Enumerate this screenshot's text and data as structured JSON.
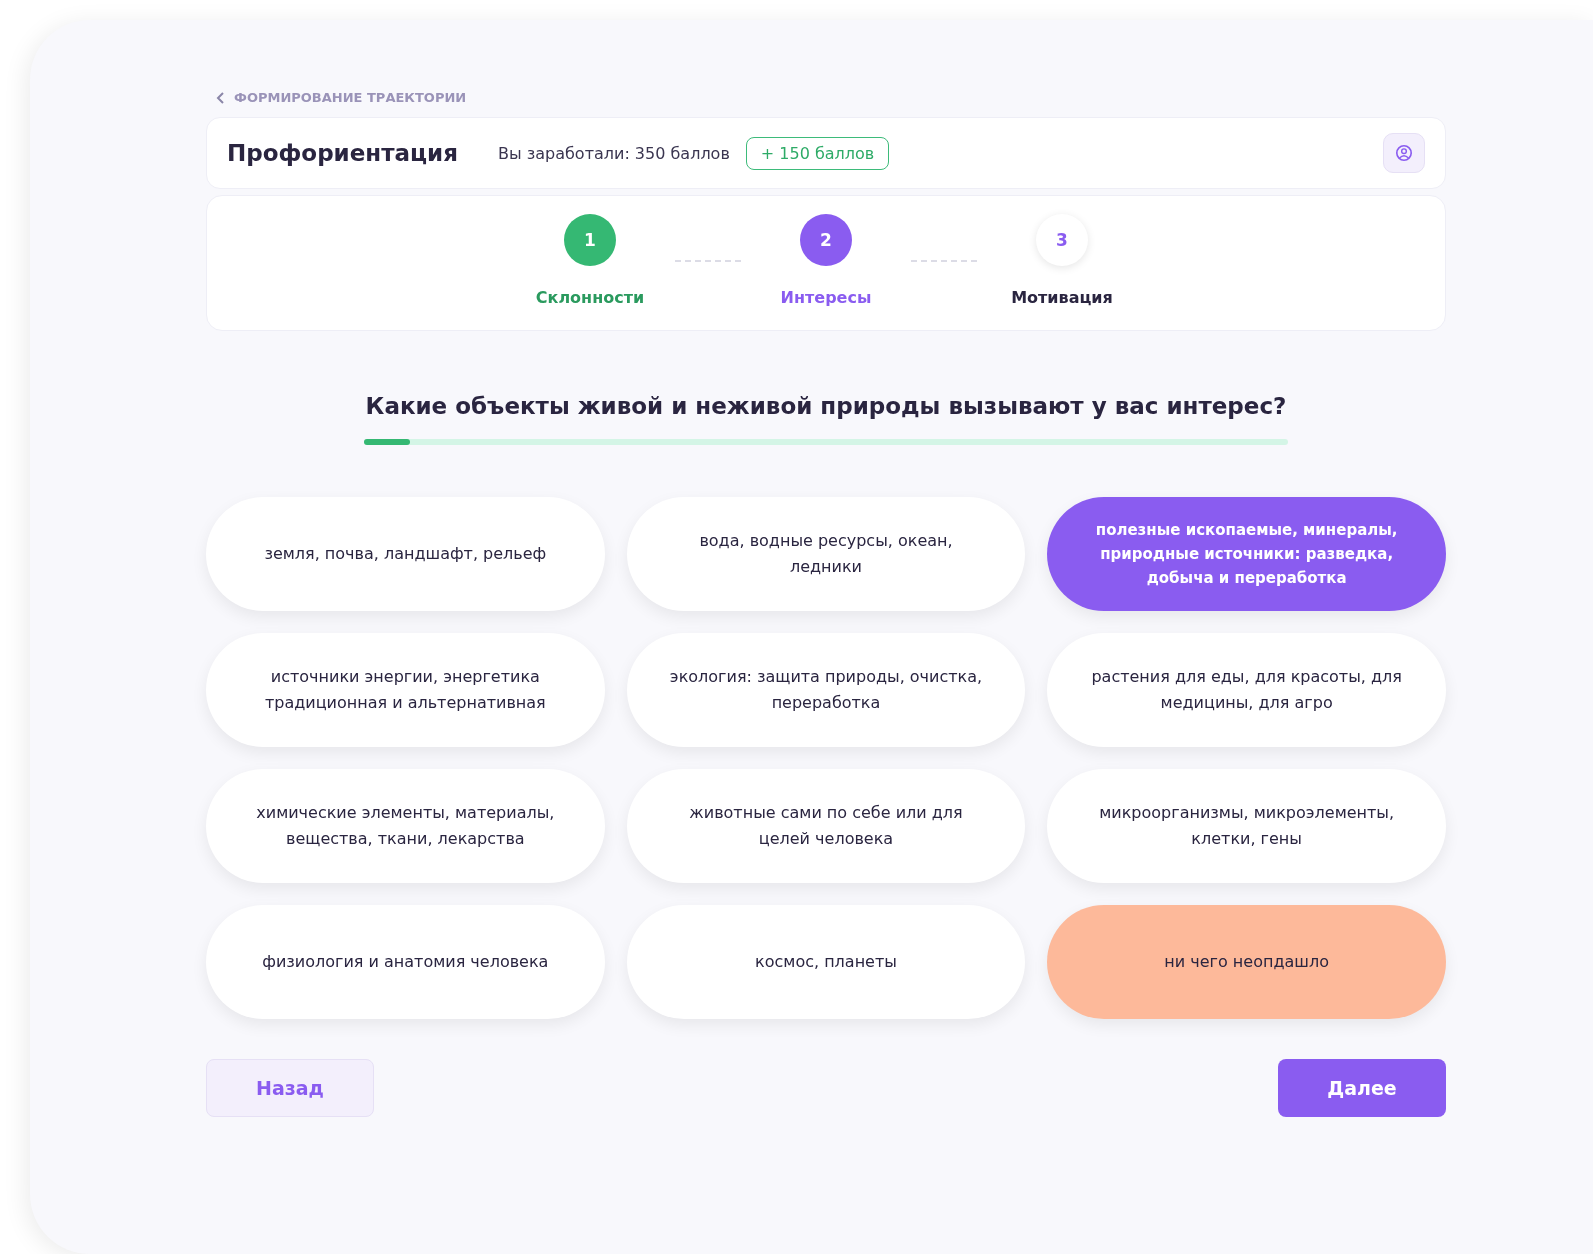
{
  "breadcrumb": {
    "label": "ФОРМИРОВАНИЕ ТРАЕКТОРИИ"
  },
  "header": {
    "title": "Профориентация",
    "earned": "Вы заработали: 350 баллов",
    "bonus": "+ 150 баллов"
  },
  "steps": [
    {
      "number": "1",
      "label": "Склонности",
      "completed": true,
      "selected": false
    },
    {
      "number": "2",
      "label": "Интересы",
      "completed": false,
      "selected": true
    },
    {
      "number": "3",
      "label": "Мотивация",
      "completed": false,
      "selected": false
    }
  ],
  "question": {
    "text": "Какие объекты живой и неживой природы вызывают у вас интерес?",
    "level": 0.05
  },
  "options": [
    {
      "label": "земля, почва, ландшафт, рельеф",
      "color": "#ffffff",
      "selected": false
    },
    {
      "label": "вода, водные ресурсы, океан, ледники",
      "color": "#ffffff",
      "selected": false
    },
    {
      "label": "полезные ископаемые, минералы, природные источники: разведка, добыча и переработка",
      "color": "#8a5cf0",
      "selected": true
    },
    {
      "label": "источники энергии, энергетика традиционная и альтернативная",
      "color": "#ffffff",
      "selected": false
    },
    {
      "label": "экология: защита природы, очистка, переработка",
      "color": "#ffffff",
      "selected": false
    },
    {
      "label": "растения для еды, для красоты, для медицины, для агро",
      "color": "#ffffff",
      "selected": false
    },
    {
      "label": "химические элементы, материалы, вещества, ткани, лекарства",
      "color": "#ffffff",
      "selected": false
    },
    {
      "label": "животные сами по себе или для целей человека",
      "color": "#ffffff",
      "selected": false
    },
    {
      "label": "микроорганизмы, микроэлементы, клетки, гены",
      "color": "#ffffff",
      "selected": false
    },
    {
      "label": "физиология и анатомия человека",
      "color": "#ffffff",
      "selected": false
    },
    {
      "label": "космос, планеты",
      "color": "#ffffff",
      "selected": false
    },
    {
      "label": "ни чего неопдашло",
      "color": "#fdb99a",
      "selected": false
    }
  ],
  "buttons": {
    "back": "Назад",
    "next": "Далее"
  }
}
